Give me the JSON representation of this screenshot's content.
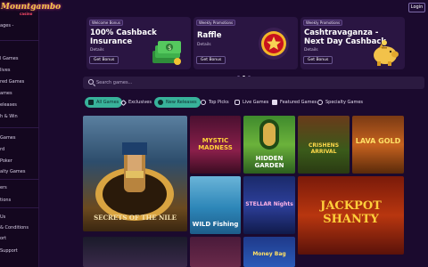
{
  "brand": {
    "logo_text": "Mountgambo",
    "logo_sub": "casino"
  },
  "top": {
    "login_label": "Login"
  },
  "sidebar": {
    "items": [
      {
        "label": "ages -"
      },
      {
        "label": "l Games"
      },
      {
        "label": "lives"
      },
      {
        "label": "red Games"
      },
      {
        "label": "ames"
      },
      {
        "label": "eleases"
      },
      {
        "label": "h & Win"
      },
      {
        "label": "Games"
      },
      {
        "label": "rd"
      },
      {
        "label": "Poker"
      },
      {
        "label": "alty Games"
      },
      {
        "label": "ers"
      },
      {
        "label": "tions"
      },
      {
        "label": "Us"
      },
      {
        "label": "& Conditions"
      },
      {
        "label": "ort"
      },
      {
        "label": "Support"
      }
    ]
  },
  "promos": [
    {
      "badge": "Welcome Bonus",
      "title_line1": "100% Cashback",
      "title_line2": "Insurance",
      "details": "Details",
      "button": "Get Bonus",
      "icon": "cash-stack-icon"
    },
    {
      "badge": "Weekly Promotions",
      "title_line1": "Raffle",
      "title_line2": "",
      "details": "Details",
      "button": "Get Bonus",
      "icon": "star-coin-icon"
    },
    {
      "badge": "Weekly Promotions",
      "title_line1": "Cashtravaganza -",
      "title_line2": "Next Day Cashback",
      "details": "Details",
      "button": "Get Bonus",
      "icon": "piggy-bank-icon"
    }
  ],
  "carousel": {
    "active_index": 1,
    "count": 3
  },
  "search": {
    "placeholder": "Search games...",
    "value": ""
  },
  "tabs": [
    {
      "label": "All Games",
      "active": true,
      "icon": "grid-icon"
    },
    {
      "label": "Exclusives",
      "active": false,
      "icon": "diamond-icon"
    },
    {
      "label": "New Releases",
      "active": true,
      "icon": "sparkle-icon"
    },
    {
      "label": "Top Picks",
      "active": false,
      "icon": "thumb-icon"
    },
    {
      "label": "Live Games",
      "active": false,
      "icon": "chat-icon"
    },
    {
      "label": "Featured Games",
      "active": false,
      "icon": "puzzle-icon"
    },
    {
      "label": "Specialty Games",
      "active": false,
      "icon": "chip-icon"
    }
  ],
  "games": [
    {
      "title": "SECRETS OF THE NILE"
    },
    {
      "title": "MYSTIC MADNESS"
    },
    {
      "title": "HIDDEN GARDEN"
    },
    {
      "title": "CRISHENS ARRIVAL"
    },
    {
      "title": "LAVA GOLD"
    },
    {
      "title": "WILD Fishing"
    },
    {
      "title": "STELLAR Nights"
    },
    {
      "title": "JACKPOT SHANTY"
    },
    {
      "title": ""
    },
    {
      "title": ""
    },
    {
      "title": "Money Bag"
    }
  ],
  "colors": {
    "background": "#1b0a2e",
    "sidebar": "#14071f",
    "card": "#2a1542",
    "accent": "#38b29a"
  }
}
